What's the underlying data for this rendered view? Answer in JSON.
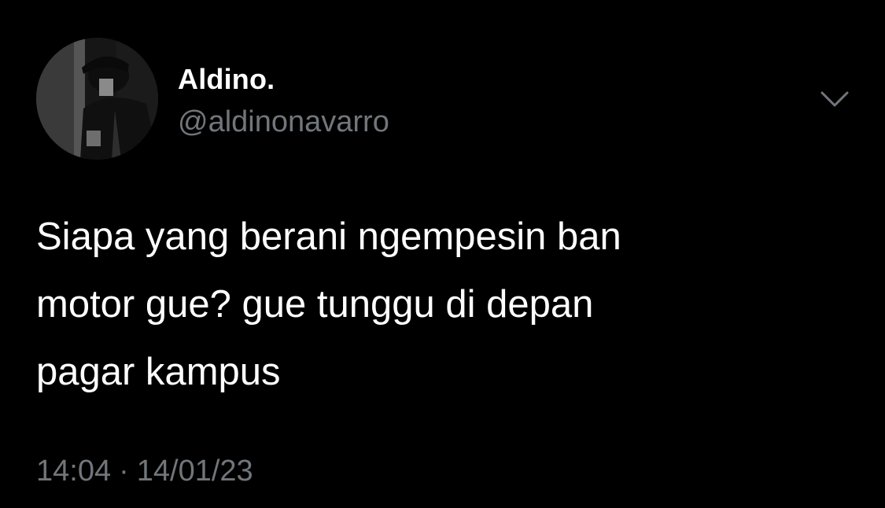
{
  "author": {
    "display_name": "Aldino.",
    "handle": "@aldinonavarro",
    "avatar_icon": "profile-photo"
  },
  "tweet": {
    "lines": [
      "Siapa yang berani ngempesin ban",
      "motor gue? gue tunggu di depan",
      "pagar kampus"
    ]
  },
  "meta": {
    "time": "14:04",
    "separator": "·",
    "date": "14/01/23"
  },
  "icons": {
    "more": "chevron-down-icon"
  },
  "colors": {
    "background": "#000000",
    "primary_text": "#ffffff",
    "secondary_text": "#71767b"
  }
}
